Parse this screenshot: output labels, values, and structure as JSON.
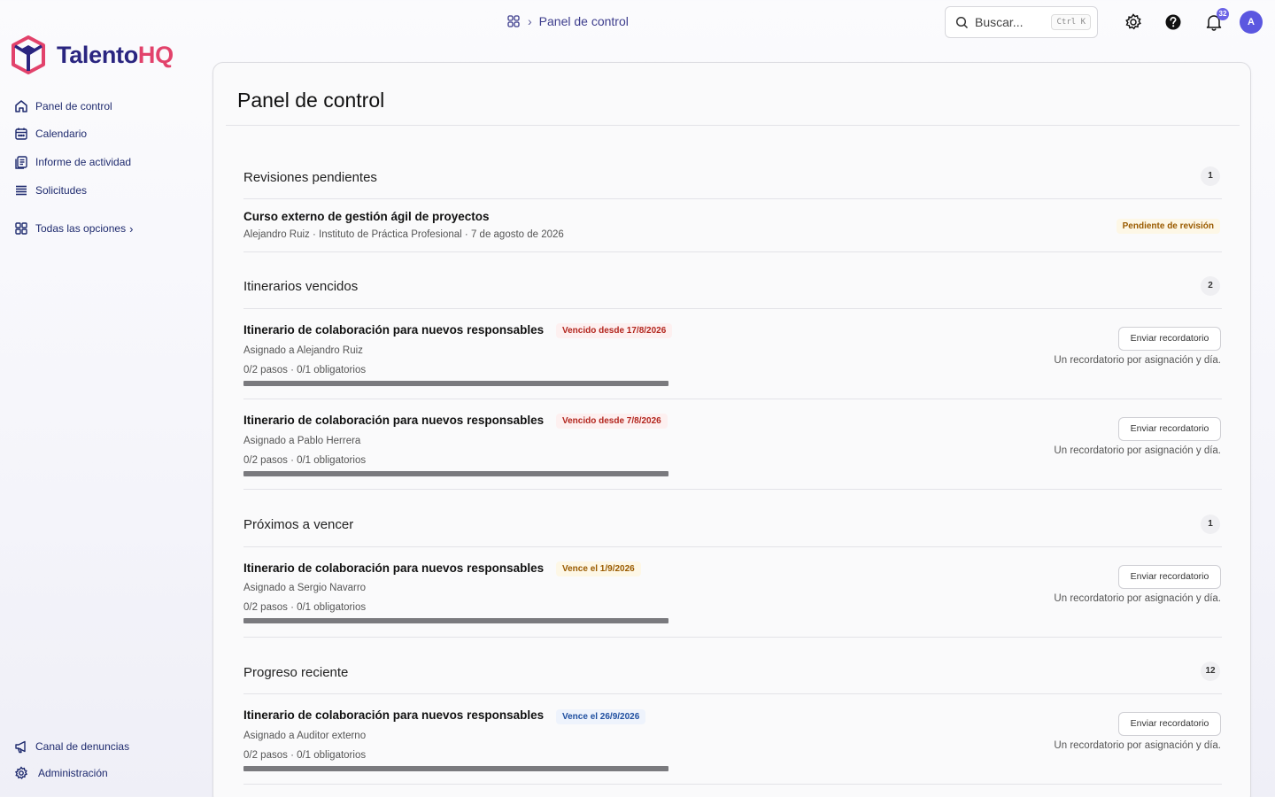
{
  "brand": {
    "name_part1": "Talento",
    "name_part2": "HQ",
    "color_primary": "#2a2580",
    "color_accent": "#e2426b"
  },
  "sidebar": {
    "items": [
      {
        "label": "Panel de control",
        "icon": "home-icon"
      },
      {
        "label": "Calendario",
        "icon": "calendar-icon"
      },
      {
        "label": "Informe de actividad",
        "icon": "report-icon"
      },
      {
        "label": "Solicitudes",
        "icon": "list-icon"
      },
      {
        "label": "Todas las opciones",
        "icon": "grid-icon",
        "chevron": "›"
      }
    ],
    "footer": [
      {
        "label": "Canal de denuncias",
        "icon": "megaphone-icon"
      },
      {
        "label": "Administración",
        "icon": "gear-icon"
      }
    ]
  },
  "topbar": {
    "breadcrumb": {
      "sep": "›",
      "current": "Panel de control"
    },
    "search": {
      "placeholder": "Buscar...",
      "shortcut": "Ctrl K"
    },
    "notifications_count": "32",
    "avatar_initial": "A"
  },
  "main": {
    "title": "Panel de control",
    "sections": [
      {
        "title": "Revisiones pendientes",
        "count": "1",
        "rows": [
          {
            "title": "Curso externo de gestión ágil de proyectos",
            "meta": "Alejandro Ruiz · Instituto de Práctica Profesional · 7 de agosto de 2026",
            "tag": "Pendiente de revisión",
            "tag_color": "#9a5b00"
          }
        ]
      },
      {
        "title": "Itinerarios vencidos",
        "count": "2",
        "rows": [
          {
            "title": "Itinerario de colaboración para nuevos responsables",
            "tag": "Vencido desde 17/8/2026",
            "assigned": "Asignado a Alejandro Ruiz",
            "steps": "0/2 pasos · 0/1 obligatorios",
            "progress": 0,
            "button": "Enviar recordatorio",
            "hint": "Un recordatorio por asignación y día."
          },
          {
            "title": "Itinerario de colaboración para nuevos responsables",
            "tag": "Vencido desde 7/8/2026",
            "assigned": "Asignado a Pablo Herrera",
            "steps": "0/2 pasos · 0/1 obligatorios",
            "progress": 0,
            "button": "Enviar recordatorio",
            "hint": "Un recordatorio por asignación y día."
          }
        ]
      },
      {
        "title": "Próximos a vencer",
        "count": "1",
        "rows": [
          {
            "title": "Itinerario de colaboración para nuevos responsables",
            "tag": "Vence el 1/9/2026",
            "assigned": "Asignado a Sergio Navarro",
            "steps": "0/2 pasos · 0/1 obligatorios",
            "progress": 0,
            "button": "Enviar recordatorio",
            "hint": "Un recordatorio por asignación y día."
          }
        ]
      },
      {
        "title": "Progreso reciente",
        "count": "12",
        "rows": [
          {
            "title": "Itinerario de colaboración para nuevos responsables",
            "tag": "Vence el 26/9/2026",
            "assigned": "Asignado a Auditor externo",
            "steps": "0/2 pasos · 0/1 obligatorios",
            "progress": 0,
            "button": "Enviar recordatorio",
            "hint": "Un recordatorio por asignación y día."
          }
        ]
      }
    ]
  }
}
